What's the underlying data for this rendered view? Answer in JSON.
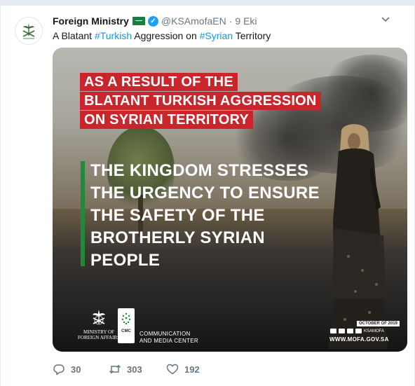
{
  "tweet": {
    "display_name": "Foreign Ministry",
    "handle": "@KSAmofaEN",
    "separator": "·",
    "time": "9 Eki",
    "text_parts": {
      "t1": "A Blatant ",
      "h1": "#Turkish",
      "t2": " Aggression on ",
      "h2": "#Syrian",
      "t3": " Territory"
    }
  },
  "media": {
    "red_lines": [
      "AS A RESULT OF THE",
      "BLATANT TURKISH AGGRESSION",
      "ON SYRIAN TERRITORY"
    ],
    "white_lines": [
      "THE KINGDOM STRESSES",
      "THE URGENCY TO ENSURE",
      "THE SAFETY OF THE",
      "BROTHERLY SYRIAN",
      "PEOPLE"
    ],
    "mofa_logo_text": [
      "MINISTRY OF",
      "FOREIGN AFFAIRS"
    ],
    "cmc_abbr": "CMC",
    "cmc_name": [
      "COMMUNICATION",
      "AND MEDIA CENTER"
    ],
    "date_badge": "OCTOBER OF 2019",
    "social_handle": "KSAMOFA",
    "website": "WWW.MOFA.GOV.SA",
    "colors": {
      "red": "#c8262c",
      "green": "#1e8a3a"
    }
  },
  "actions": {
    "reply_count": "30",
    "retweet_count": "303",
    "like_count": "192"
  },
  "icons": {
    "reply": "reply-icon",
    "retweet": "retweet-icon",
    "like": "heart-icon",
    "caret": "chevron-down-icon",
    "verified": "verified-badge-icon"
  }
}
